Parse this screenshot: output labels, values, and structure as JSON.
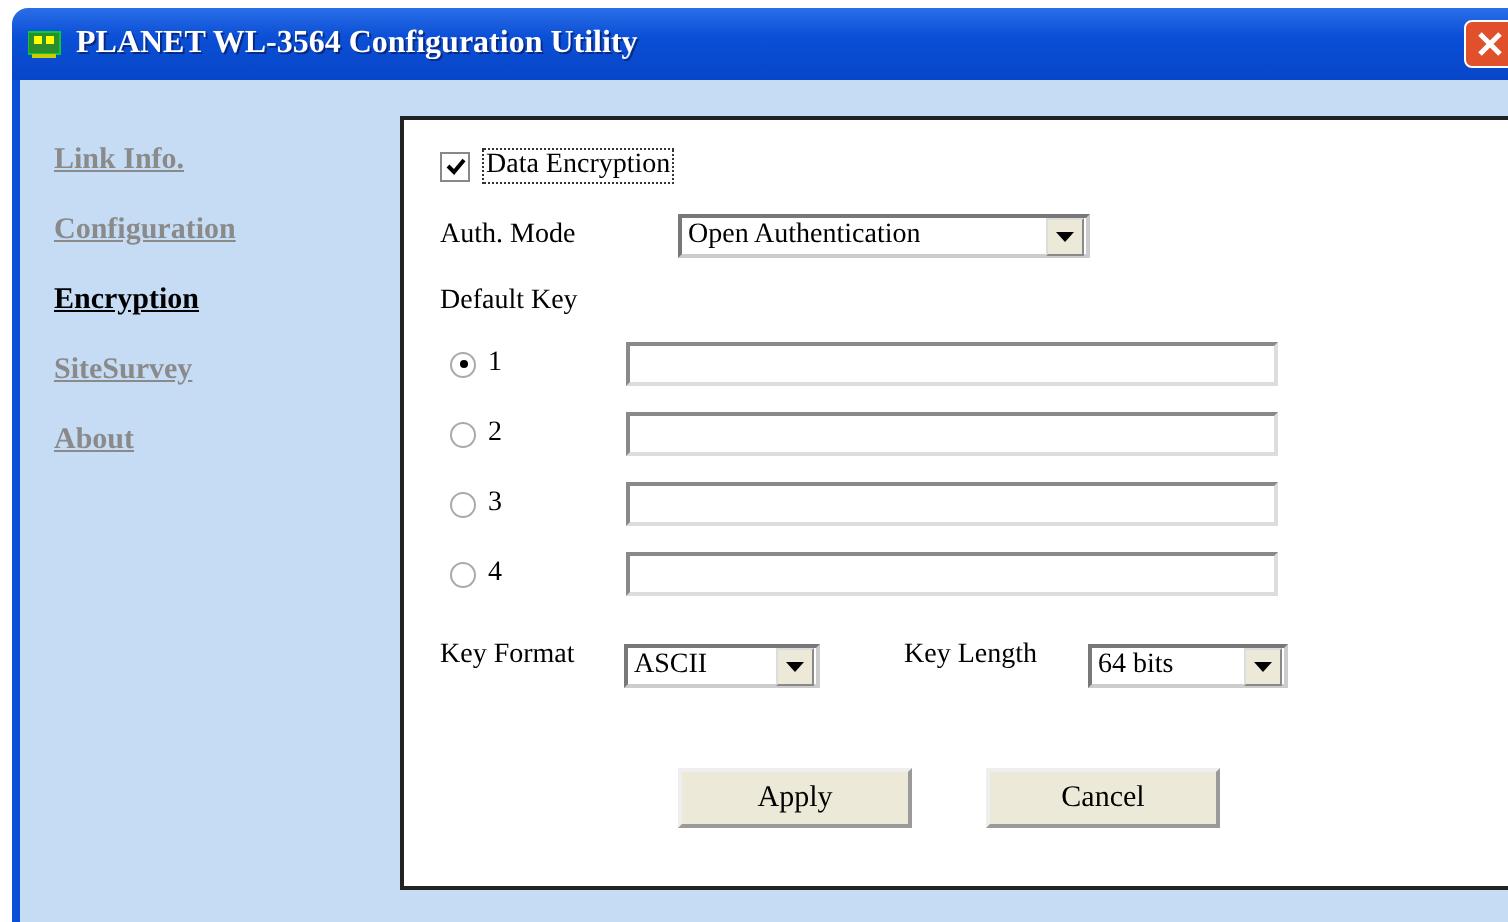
{
  "window": {
    "title": "PLANET WL-3564 Configuration Utility"
  },
  "sidebar": {
    "items": [
      {
        "label": "Link Info.",
        "selected": false
      },
      {
        "label": "Configuration",
        "selected": false
      },
      {
        "label": "Encryption",
        "selected": true
      },
      {
        "label": "SiteSurvey",
        "selected": false
      },
      {
        "label": "About",
        "selected": false
      }
    ]
  },
  "encryption": {
    "data_encryption": {
      "label": "Data Encryption",
      "checked": true
    },
    "auth_mode": {
      "label": "Auth. Mode",
      "value": "Open Authentication"
    },
    "default_key": {
      "label": "Default Key",
      "keys": [
        {
          "label": "1",
          "selected": true
        },
        {
          "label": "2",
          "selected": false
        },
        {
          "label": "3",
          "selected": false
        },
        {
          "label": "4",
          "selected": false
        }
      ]
    },
    "key_format": {
      "label": "Key Format",
      "value": "ASCII"
    },
    "key_length": {
      "label": "Key Length",
      "value": "64 bits"
    },
    "buttons": [
      "Apply",
      "Cancel"
    ]
  }
}
